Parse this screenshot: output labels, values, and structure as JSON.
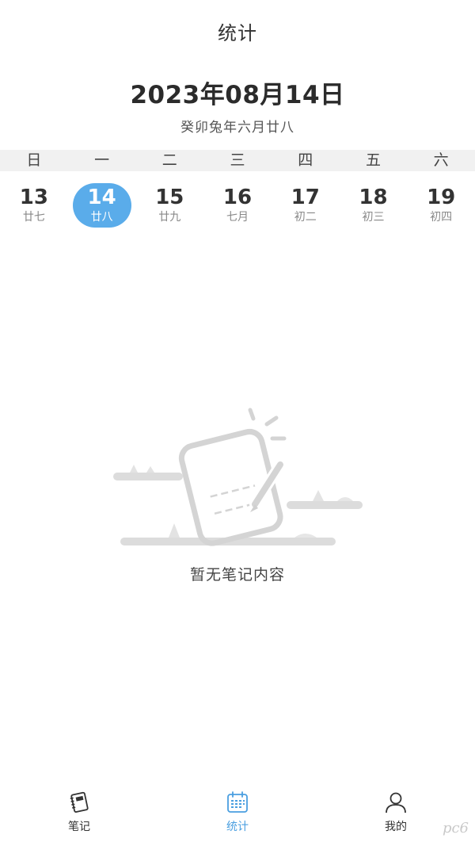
{
  "header": {
    "title": "统计"
  },
  "calendar": {
    "date_title": "2023年08月14日",
    "lunar_subtitle": "癸卯兔年六月廿八",
    "weekdays": [
      "日",
      "一",
      "二",
      "三",
      "四",
      "五",
      "六"
    ],
    "days": [
      {
        "day": "13",
        "lunar": "廿七",
        "selected": false
      },
      {
        "day": "14",
        "lunar": "廿八",
        "selected": true
      },
      {
        "day": "15",
        "lunar": "廿九",
        "selected": false
      },
      {
        "day": "16",
        "lunar": "七月",
        "selected": false
      },
      {
        "day": "17",
        "lunar": "初二",
        "selected": false
      },
      {
        "day": "18",
        "lunar": "初三",
        "selected": false
      },
      {
        "day": "19",
        "lunar": "初四",
        "selected": false
      }
    ],
    "selected_color": "#5aacea"
  },
  "empty_state": {
    "message": "暂无笔记内容",
    "illustration": "empty-notebook-illustration"
  },
  "tab_bar": {
    "tabs": [
      {
        "label": "笔记",
        "icon": "notebook-icon",
        "active": false
      },
      {
        "label": "统计",
        "icon": "calendar-grid-icon",
        "active": true
      },
      {
        "label": "我的",
        "icon": "user-icon",
        "active": false
      }
    ],
    "active_color": "#4a9fe0"
  },
  "watermark": {
    "text": "pc6"
  }
}
